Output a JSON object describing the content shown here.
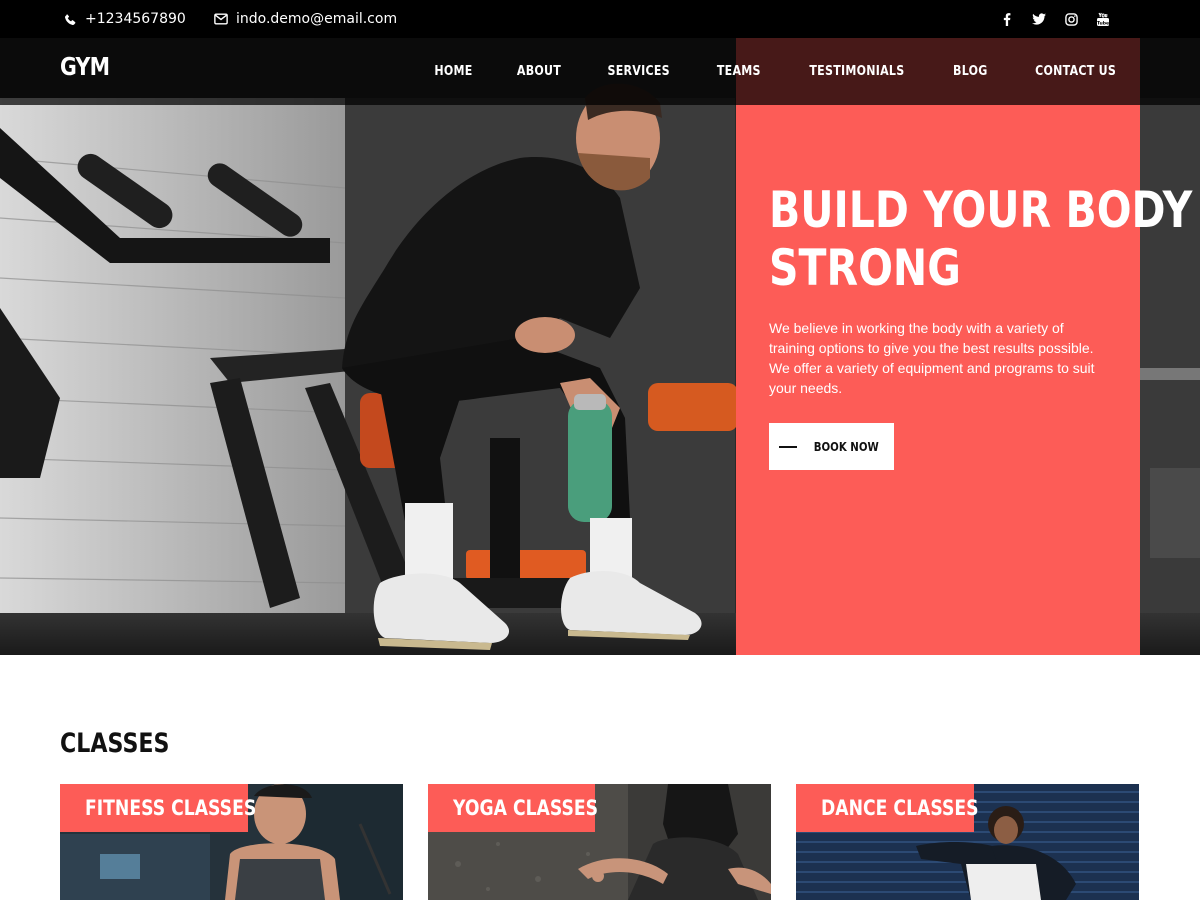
{
  "topbar": {
    "phone": "+1234567890",
    "email": "indo.demo@email.com",
    "social": [
      "facebook-icon",
      "twitter-icon",
      "instagram-icon",
      "youtube-icon"
    ]
  },
  "header": {
    "logo": "GYM",
    "nav": [
      "HOME",
      "ABOUT",
      "SERVICES",
      "TEAMS",
      "TESTIMONIALS",
      "BLOG",
      "CONTACT US"
    ]
  },
  "hero": {
    "heading_line1": "BUILD YOUR BODY",
    "heading_line2": "STRONG",
    "description": "We believe in working the body with a variety of training options to give you the best results possible. We offer a variety of equipment and programs to suit your needs.",
    "button": "BOOK NOW"
  },
  "classes": {
    "title": "CLASSES",
    "items": [
      {
        "label": "FITNESS CLASSES"
      },
      {
        "label": "YOGA CLASSES"
      },
      {
        "label": "DANCE CLASSES"
      }
    ]
  },
  "colors": {
    "accent": "#fd5c57",
    "topbar": "#000000",
    "text_dark": "#111111"
  }
}
